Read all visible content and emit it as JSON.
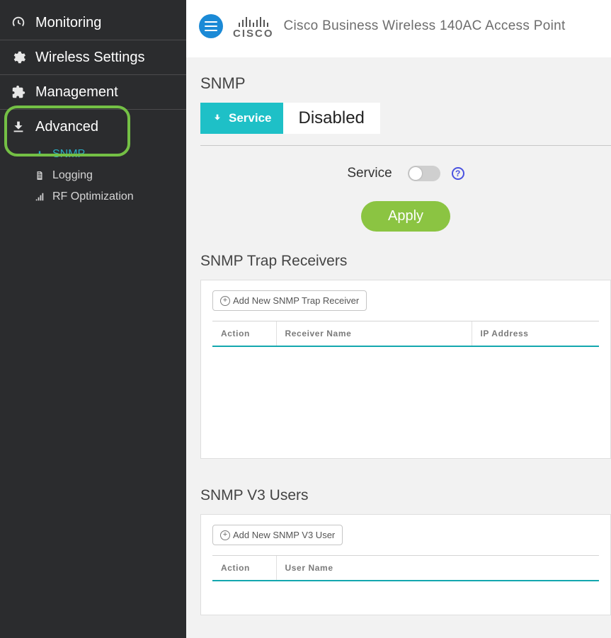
{
  "header": {
    "brand_word": "CISCO",
    "product_title": "Cisco Business Wireless 140AC Access Point"
  },
  "sidebar": {
    "items": [
      {
        "label": "Monitoring"
      },
      {
        "label": "Wireless Settings"
      },
      {
        "label": "Management"
      },
      {
        "label": "Advanced",
        "sub": [
          {
            "label": "SNMP",
            "active": true
          },
          {
            "label": "Logging"
          },
          {
            "label": "RF Optimization"
          }
        ]
      }
    ]
  },
  "snmp": {
    "section_title": "SNMP",
    "status_tag_label": "Service",
    "status_value": "Disabled",
    "service_label": "Service",
    "apply_label": "Apply",
    "help_glyph": "?"
  },
  "trap": {
    "title": "SNMP Trap Receivers",
    "add_label": "Add New SNMP Trap Receiver",
    "columns": {
      "action": "Action",
      "name": "Receiver Name",
      "ip": "IP Address"
    }
  },
  "v3": {
    "title": "SNMP V3 Users",
    "add_label": "Add New SNMP V3 User",
    "columns": {
      "action": "Action",
      "name": "User Name"
    }
  }
}
